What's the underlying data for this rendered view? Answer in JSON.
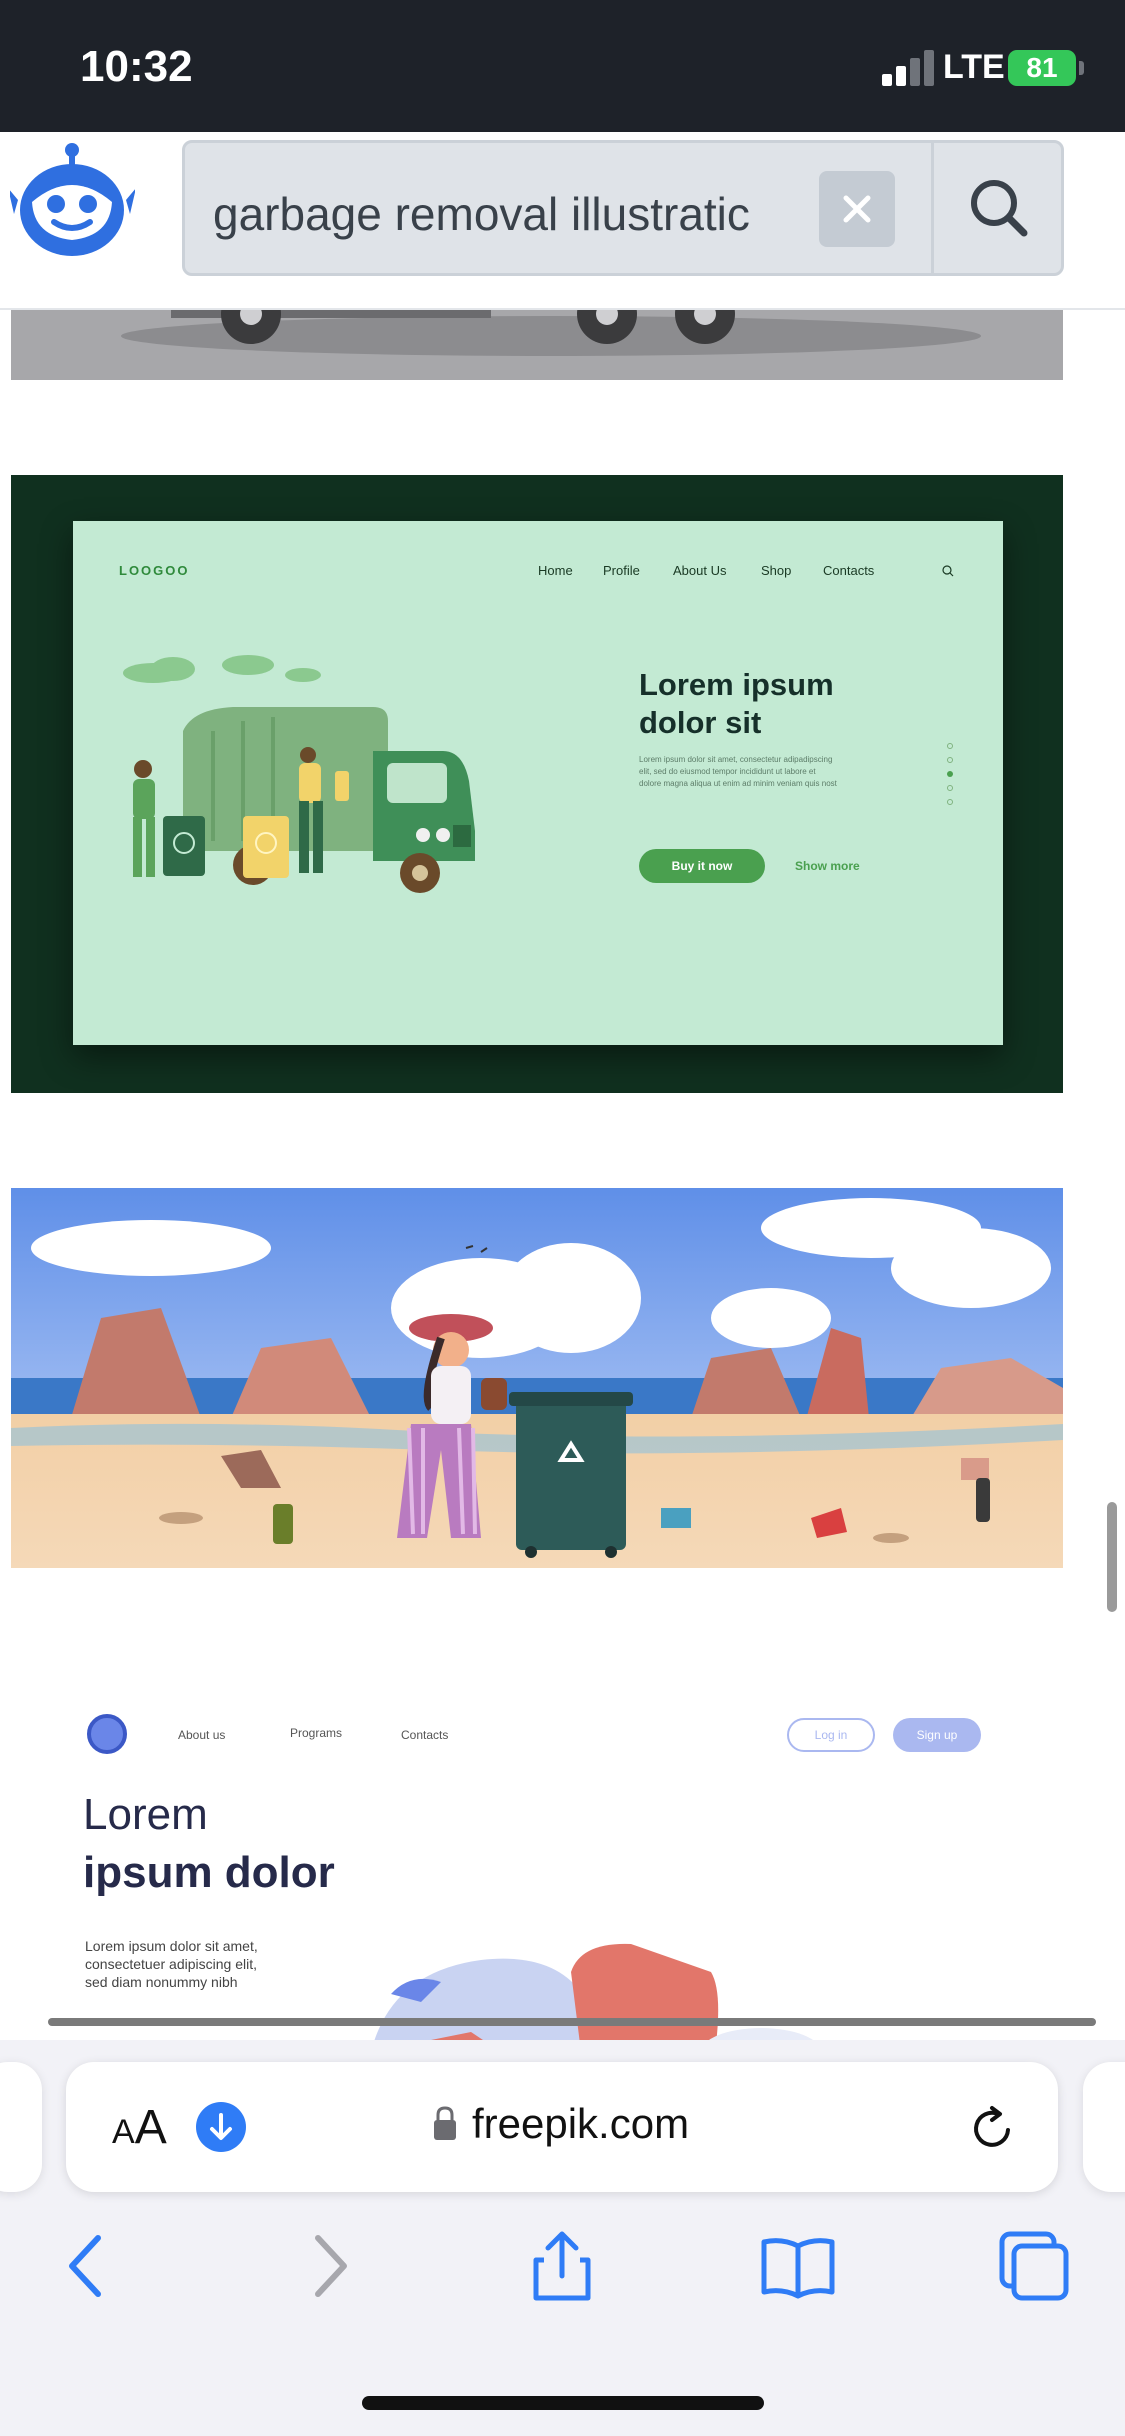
{
  "status_bar": {
    "time": "10:32",
    "network": "LTE",
    "battery": "81",
    "signal_bars": 2
  },
  "header": {
    "logo_icon": "robot-mascot-icon",
    "search": {
      "value": "garbage removal illustratic",
      "clear_icon": "close-icon",
      "search_icon": "search-icon"
    }
  },
  "results": {
    "card2": {
      "logo": "LOOGOO",
      "nav": [
        "Home",
        "Profile",
        "About Us",
        "Shop",
        "Contacts"
      ],
      "headline_1": "Lorem ipsum",
      "headline_2": "dolor sit",
      "body_1": "Lorem ipsum dolor sit amet, consectetur adipadipscing",
      "body_2": "elit, sed do eiusmod tempor incididunt ut labore et",
      "body_3": "dolore magna aliqua ut enim ad minim veniam quis nost",
      "cta_primary": "Buy it now",
      "cta_secondary": "Show more"
    },
    "card4": {
      "nav": [
        "About us",
        "Programs",
        "Contacts"
      ],
      "login": "Log in",
      "signup": "Sign up",
      "headline_1": "Lorem",
      "headline_2": "ipsum dolor",
      "body_1": "Lorem ipsum dolor sit amet,",
      "body_2": "consectetuer adipiscing elit,",
      "body_3": "sed diam nonummy nibh"
    }
  },
  "browser": {
    "text_size_label_small": "A",
    "text_size_label_large": "A",
    "domain": "freepik.com",
    "toolbar": [
      "back-icon",
      "forward-icon",
      "share-icon",
      "bookmarks-icon",
      "tabs-icon"
    ]
  },
  "colors": {
    "status_bar_bg": "#1e2229",
    "accent_blue": "#2f7cf6",
    "card2_bg": "#10301f",
    "card2_panel": "#c3ead3",
    "card2_green": "#4aa04f",
    "battery_green": "#34c759"
  }
}
